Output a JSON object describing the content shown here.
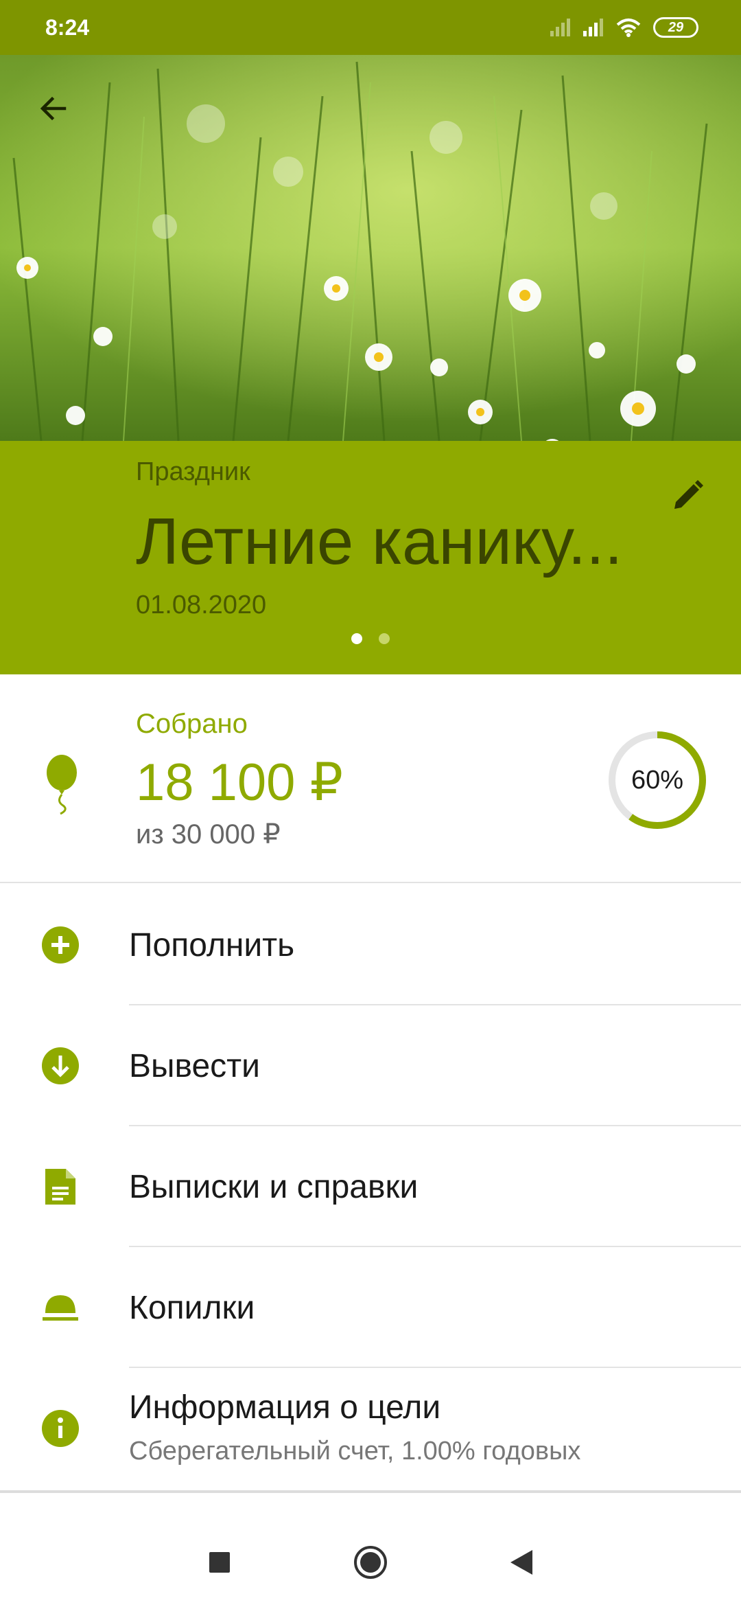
{
  "status_bar": {
    "time": "8:24",
    "battery": "29",
    "icons": [
      "signal-icon",
      "signal-icon",
      "wifi-icon",
      "battery-icon"
    ]
  },
  "hero": {
    "image": "meadow with daisies",
    "back_icon": "arrow-left-icon"
  },
  "goal": {
    "category": "Праздник",
    "title": "Летние канику...",
    "date": "01.08.2020",
    "edit_icon": "pencil-icon",
    "pages": 2,
    "active_page": 0
  },
  "collected": {
    "label": "Собрано",
    "amount": "18 100 ₽",
    "target": "из 30 000 ₽",
    "percent_text": "60%",
    "progress": 0.6,
    "icon": "balloon-icon"
  },
  "menu": {
    "items": [
      {
        "label": "Пополнить",
        "icon": "plus-circle-icon"
      },
      {
        "label": "Вывести",
        "icon": "arrow-down-circle-icon"
      },
      {
        "label": "Выписки и справки",
        "icon": "document-icon"
      },
      {
        "label": "Копилки",
        "icon": "piggy-dome-icon"
      },
      {
        "label": "Информация о цели",
        "sublabel": "Сберегательный счет, 1.00% годовых",
        "icon": "info-icon"
      }
    ]
  },
  "nav": {
    "buttons": [
      "recents-icon",
      "home-icon",
      "back-icon"
    ]
  },
  "colors": {
    "accent": "#8faa00",
    "status_bar": "#7e9500",
    "header_text": "#3a4500"
  }
}
